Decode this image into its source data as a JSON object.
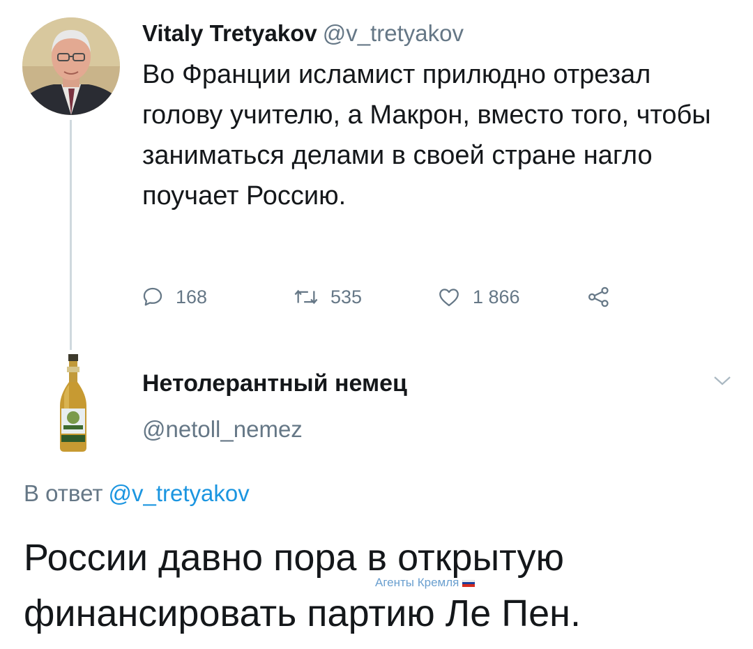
{
  "colors": {
    "text": "#14171a",
    "secondary": "#657786",
    "link": "#1b95e0",
    "thread_line": "#cfd9de",
    "watermark": "#6a9fcf"
  },
  "tweet": {
    "author_name": "Vitaly Tretyakov",
    "author_handle": "@v_tretyakov",
    "avatar_icon": "user-photo-avatar",
    "text": "Во Франции исламист прилюдно отрезал голову учителю, а Макрон, вместо того, чтобы заниматься делами в своей стране нагло поучает Россию.",
    "actions": {
      "replies": "168",
      "retweets": "535",
      "likes": "1 866",
      "reply_icon": "speech-bubble-icon",
      "retweet_icon": "retweet-icon",
      "like_icon": "heart-icon",
      "share_icon": "share-icon"
    }
  },
  "reply": {
    "author_name": "Нетолерантный немец",
    "author_handle": "@netoll_nemez",
    "avatar_icon": "beer-bottle-avatar",
    "menu_icon": "chevron-down-icon",
    "in_reply_prefix": "В ответ",
    "in_reply_handle": "@v_tretyakov",
    "text": "России давно пора в открытую финансировать партию Ле Пен."
  },
  "watermark": {
    "text": "Агенты Кремля",
    "icon": "russian-flag-icon"
  }
}
